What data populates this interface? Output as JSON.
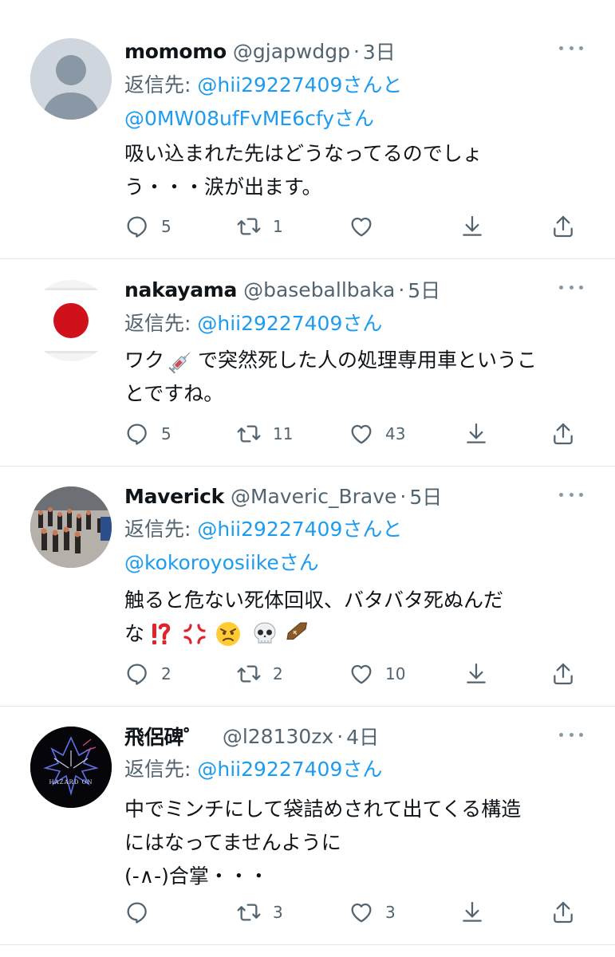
{
  "tweets": [
    {
      "name": "momomo",
      "handle": "@gjapwdgp",
      "dot": "·",
      "time": "3日",
      "reply_prefix": "返信先: ",
      "reply_mention1": "@hii29227409",
      "reply_mid": "さんと",
      "reply_mention2": "@0MW08ufFvME6cfy",
      "reply_suffix": "さん",
      "body_line1": "吸い込まれた先はどうなってるのでしょ",
      "body_line2": "う・・・涙が出ます。",
      "replies": "5",
      "retweets": "1",
      "likes": ""
    },
    {
      "name": "nakayama",
      "handle": "@baseballbaka",
      "dot": "·",
      "time": "5日",
      "reply_prefix": "返信先: ",
      "reply_mention1": "@hii29227409",
      "reply_suffix": "さん",
      "body_pre": "ワク",
      "body_post": "で突然死した人の処理専用車というこ",
      "body_line2": "とですね。",
      "replies": "5",
      "retweets": "11",
      "likes": "43"
    },
    {
      "name": "Maverick",
      "handle": "@Maveric_Brave",
      "dot": "·",
      "time": "5日",
      "reply_prefix": "返信先: ",
      "reply_mention1": "@hii29227409",
      "reply_mid": "さんと",
      "reply_mention2": "@kokoroyosiike",
      "reply_suffix": "さん",
      "body_line1": "触ると危ない死体回収、バタバタ死ぬんだ",
      "body_line2_prefix": "な",
      "replies": "2",
      "retweets": "2",
      "likes": "10"
    },
    {
      "name": "飛侶碑゜",
      "handle": "@l28130zx",
      "dot": "·",
      "time": "4日",
      "reply_prefix": "返信先: ",
      "reply_mention1": "@hii29227409",
      "reply_suffix": "さん",
      "body_line1": "中でミンチにして袋詰めされて出てくる構造",
      "body_line2": "にはなってませんように",
      "body_line3": "(-∧-)合掌・・・",
      "avatar_text": "HAZARD ON",
      "replies": "",
      "retweets": "3",
      "likes": "3"
    }
  ],
  "colors": {
    "link": "#1d9bf0",
    "secondary": "#536471",
    "text": "#0f1419",
    "divider": "#e1e8ed"
  },
  "icons": [
    "reply-icon",
    "retweet-icon",
    "like-icon",
    "download-icon",
    "share-icon",
    "more-icon",
    "syringe-emoji",
    "interrobang-emoji",
    "anger-emoji",
    "angry-face-emoji",
    "skull-emoji",
    "coffin-emoji"
  ]
}
